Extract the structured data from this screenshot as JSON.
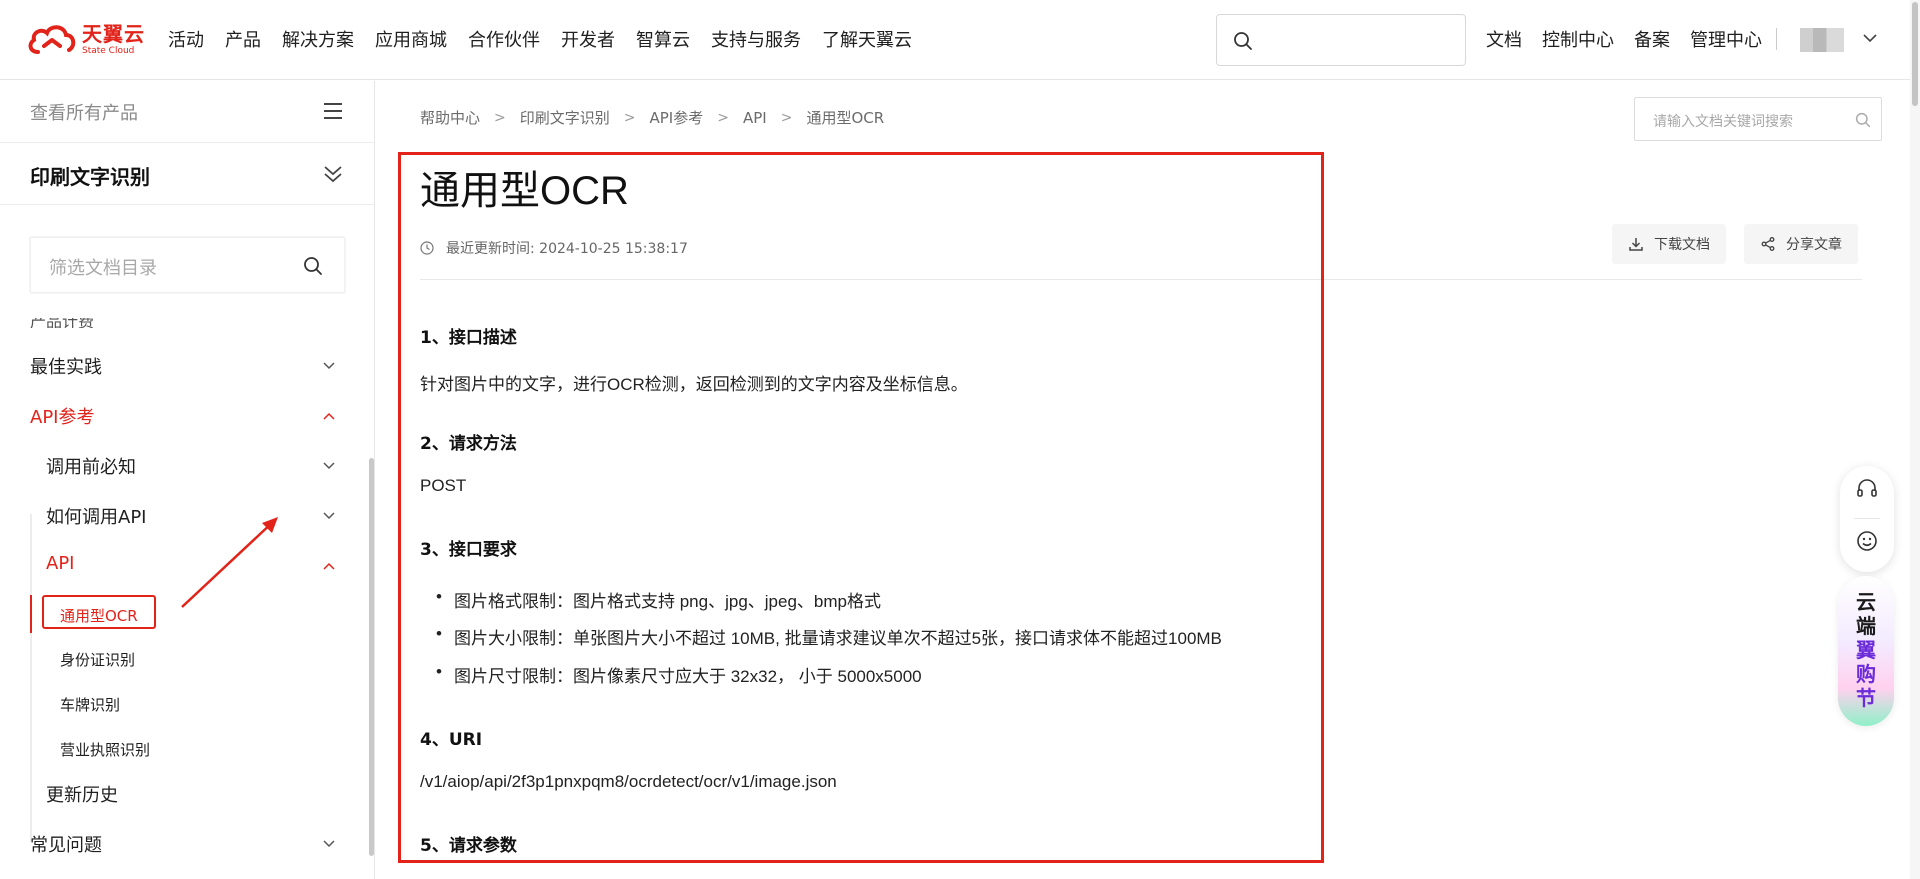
{
  "brand": {
    "name_cn": "天翼云",
    "name_en": "State Cloud"
  },
  "nav": [
    "活动",
    "产品",
    "解决方案",
    "应用商城",
    "合作伙伴",
    "开发者",
    "智算云",
    "支持与服务",
    "了解天翼云"
  ],
  "top_links": [
    "文档",
    "控制中心",
    "备案",
    "管理中心"
  ],
  "sidebar": {
    "all_products": "查看所有产品",
    "product": "印刷文字识别",
    "filter_placeholder": "筛选文档目录",
    "cut_item": "产品计费",
    "items": {
      "best_practice": "最佳实践",
      "api_ref": "API参考",
      "before_call": "调用前必知",
      "how_call": "如何调用API",
      "api": "API",
      "general_ocr": "通用型OCR",
      "id_card": "身份证识别",
      "plate": "车牌识别",
      "license": "营业执照识别",
      "history": "更新历史",
      "faq": "常见问题"
    }
  },
  "breadcrumb": [
    "帮助中心",
    "印刷文字识别",
    "API参考",
    "API",
    "通用型OCR"
  ],
  "doc_search_placeholder": "请输入文档关键词搜索",
  "doc": {
    "title": "通用型OCR",
    "updated": "最近更新时间: 2024-10-25 15:38:17",
    "download": "下载文档",
    "share": "分享文章",
    "s1_title": "1、接口描述",
    "s1_body": "针对图片中的文字，进行OCR检测，返回检测到的文字内容及坐标信息。",
    "s2_title": "2、请求方法",
    "s2_body": "POST",
    "s3_title": "3、接口要求",
    "s3_items": [
      "图片格式限制：图片格式支持 png、jpg、jpeg、bmp格式",
      "图片大小限制：单张图片大小不超过 10MB, 批量请求建议单次不超过5张，接口请求体不能超过100MB",
      "图片尺寸限制：图片像素尺寸应大于 32x32， 小于 5000x5000"
    ],
    "s4_title": "4、URI",
    "s4_body": "/v1/aiop/api/2f3p1pnxpqm8/ocrdetect/ocr/v1/image.json",
    "s5_title": "5、请求参数"
  },
  "promo": {
    "line1": "云端",
    "line2": "翼购节"
  },
  "icons": {
    "search": "search-icon",
    "menu": "menu-icon",
    "collapse": "double-chevron-down-icon",
    "chevron": "chevron-down-icon",
    "clock": "clock-icon",
    "download": "download-icon",
    "share": "share-icon",
    "headset": "headset-icon",
    "smile": "smile-icon"
  },
  "colors": {
    "accent": "#e2231a",
    "promo_purple": "#6c2bd9"
  }
}
